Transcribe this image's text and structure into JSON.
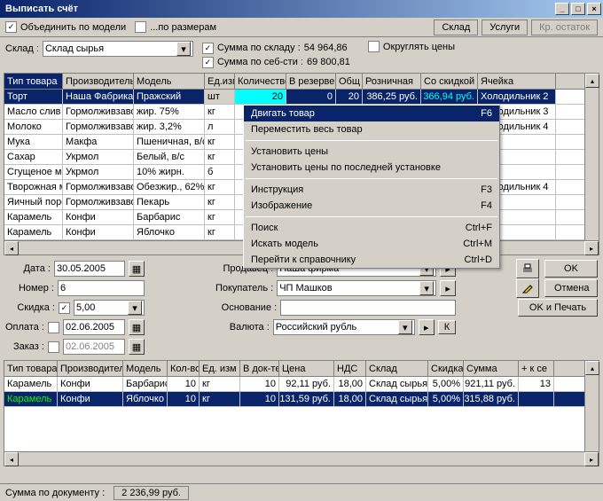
{
  "window": {
    "title": "Выписать счёт"
  },
  "toolbar": {
    "merge_by_model": "Объединить по модели",
    "by_sizes": "...по размерам",
    "tab_warehouse": "Склад",
    "tab_services": "Услуги",
    "tab_remainder": "Кр. остаток"
  },
  "row2": {
    "warehouse_label": "Склад :",
    "warehouse_value": "Склад сырья",
    "sum_warehouse_label": "Сумма по складу :",
    "sum_warehouse_value": "54 964,86",
    "sum_cost_label": "Сумма по себ-сти :",
    "sum_cost_value": "69 800,81",
    "round_prices": "Округлять цены"
  },
  "grid1": {
    "headers": [
      "Тип товара",
      "Производитель",
      "Модель",
      "Ед.изм",
      "Количество",
      "В резерве",
      "Общ",
      "Розничная",
      "Со скидкой",
      "Ячейка"
    ],
    "rows": [
      {
        "cells": [
          "Торт",
          "Наша Фабрика",
          "Пражский",
          "шт",
          "20",
          "0",
          "20",
          "386,25 руб.",
          "366,94 руб.",
          "Холодильник 2"
        ],
        "sel": true
      },
      {
        "cells": [
          "Масло слив",
          "Гормолживзавод",
          "жир. 75%",
          "кг",
          "",
          "",
          "",
          "",
          "",
          "Холодильник 3"
        ]
      },
      {
        "cells": [
          "Молоко",
          "Гормолживзавод",
          "жир. 3,2%",
          "л",
          "",
          "",
          "",
          "",
          "",
          "Холодильник 4"
        ]
      },
      {
        "cells": [
          "Мука",
          "Макфа",
          "Пшеничная, в/с",
          "кг",
          "",
          "",
          "",
          "",
          "",
          ""
        ]
      },
      {
        "cells": [
          "Сахар",
          "Укрмол",
          "Белый, в/с",
          "кг",
          "",
          "",
          "",
          "",
          "",
          ""
        ]
      },
      {
        "cells": [
          "Сгущеное мо",
          "Укрмол",
          "10% жирн.",
          "б",
          "",
          "",
          "",
          "",
          "",
          ""
        ]
      },
      {
        "cells": [
          "Творожная м",
          "Гормолживзавод",
          "Обезжир., 62%",
          "кг",
          "",
          "",
          "",
          "",
          "",
          "Холодильник 4"
        ]
      },
      {
        "cells": [
          "Яичный поро",
          "Гормолживзавод",
          "Пекарь",
          "кг",
          "",
          "",
          "",
          "",
          "",
          ""
        ]
      },
      {
        "cells": [
          "Карамель",
          "Конфи",
          "Барбарис",
          "кг",
          "",
          "",
          "",
          "",
          "",
          ""
        ]
      },
      {
        "cells": [
          "Карамель",
          "Конфи",
          "Яблочко",
          "кг",
          "",
          "",
          "",
          "",
          "",
          ""
        ]
      }
    ]
  },
  "context_menu": {
    "items": [
      {
        "label": "Двигать товар",
        "shortcut": "F6",
        "sel": true
      },
      {
        "label": "Переместить весь товар",
        "shortcut": ""
      },
      {
        "sep": true
      },
      {
        "label": "Установить цены",
        "shortcut": ""
      },
      {
        "label": "Установить цены по последней установке",
        "shortcut": ""
      },
      {
        "sep": true
      },
      {
        "label": "Инструкция",
        "shortcut": "F3"
      },
      {
        "label": "Изображение",
        "shortcut": "F4"
      },
      {
        "sep": true
      },
      {
        "label": "Поиск",
        "shortcut": "Ctrl+F"
      },
      {
        "label": "Искать модель",
        "shortcut": "Ctrl+M"
      },
      {
        "label": "Перейти к справочнику",
        "shortcut": "Ctrl+D"
      }
    ]
  },
  "form": {
    "date_label": "Дата :",
    "date_value": "30.05.2005",
    "number_label": "Номер :",
    "number_value": "6",
    "discount_label": "Скидка :",
    "discount_value": "5,00",
    "payment_label": "Оплата :",
    "payment_value": "02.06.2005",
    "order_label": "Заказ :",
    "order_value": "02.06.2005",
    "seller_label": "Продавец :",
    "seller_value": "Наша фирма",
    "buyer_label": "Покупатель :",
    "buyer_value": "ЧП Машков",
    "basis_label": "Основание :",
    "basis_value": "",
    "currency_label": "Валюта :",
    "currency_value": "Российский рубль",
    "k_button": "К",
    "ok": "OK",
    "cancel": "Отмена",
    "ok_print": "OK и Печать"
  },
  "grid2": {
    "headers": [
      "Тип товара",
      "Производитель",
      "Модель",
      "Кол-во",
      "Ед. изм",
      "В док-те",
      "Цена",
      "НДС",
      "Склад",
      "Скидка",
      "Сумма",
      "+ к се"
    ],
    "rows": [
      {
        "cells": [
          "Карамель",
          "Конфи",
          "Барбарис",
          "10",
          "кг",
          "10",
          "92,11 руб.",
          "18,00",
          "Склад сырья",
          "5,00%",
          "921,11 руб.",
          "13"
        ]
      },
      {
        "cells": [
          "Карамель",
          "Конфи",
          "Яблочко",
          "10",
          "кг",
          "10",
          "131,59 руб.",
          "18,00",
          "Склад сырья",
          "5,00%",
          "315,88 руб.",
          ""
        ],
        "sel": true
      }
    ]
  },
  "status": {
    "doc_sum_label": "Сумма по документу :",
    "doc_sum_value": "2 236,99 руб."
  }
}
